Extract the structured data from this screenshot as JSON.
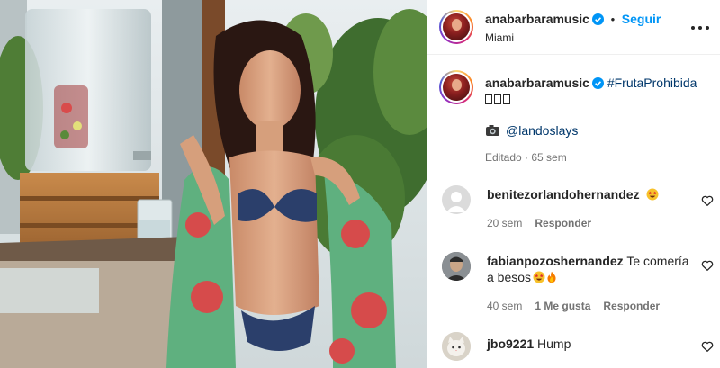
{
  "post": {
    "username": "anabarbaramusic",
    "follow_label": "Seguir",
    "location": "Miami",
    "separator": "•"
  },
  "caption": {
    "username": "anabarbaramusic",
    "hashtag": "#FrutaProhibida",
    "line2": "\u0000\u0000\u0000",
    "credit": "@landoslays",
    "meta": "Editado · 65 sem"
  },
  "comments": [
    {
      "username": "benitezorlandohernandez",
      "text": "",
      "time": "20 sem",
      "likes": "",
      "reply": "Responder"
    },
    {
      "username": "fabianpozoshernandez",
      "text": "Te comería a besos",
      "time": "40 sem",
      "likes": "1 Me gusta",
      "reply": "Responder"
    },
    {
      "username": "jbo9221",
      "text": "Hump",
      "time": "",
      "likes": "",
      "reply": ""
    }
  ],
  "colors": {
    "accent": "#0095f6",
    "link": "#00376b",
    "muted": "#737373",
    "text": "#262626"
  },
  "icons": [
    "verified-badge-icon",
    "more-options-icon",
    "camera-emoji-icon",
    "heart-icon",
    "star-struck-emoji-icon",
    "fire-emoji-icon"
  ]
}
